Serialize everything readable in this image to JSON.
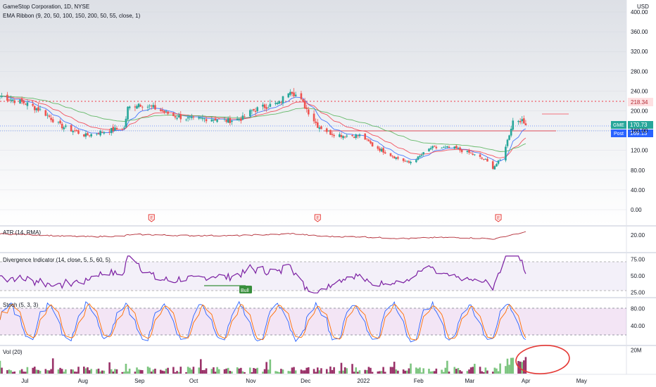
{
  "header": {
    "symbol_line": "GameStop Corporation, 1D, NYSE",
    "indicator_line": "EMA Ribbon (9, 20, 50, 100, 150, 200, 50, 55, close, 1)",
    "currency": "USD"
  },
  "panes": {
    "atr_label": "ATR (14, RMA)",
    "div_label": "Divergence Indicator (14, close, 5, 5, 60, 5)",
    "stoch_label": "Stoch (5, 3, 3)",
    "vol_label": "Vol (20)",
    "bull_label": "Bull",
    "earnings_label": "E"
  },
  "price_tags": {
    "resistance": "218.34",
    "last_symbol": "GME",
    "last_value": "170.73",
    "post_label": "Post",
    "post_value": "169.13"
  },
  "axes": {
    "price_ticks": [
      "400.00",
      "360.00",
      "320.00",
      "280.00",
      "240.00",
      "200.00",
      "160.00",
      "120.00",
      "80.00",
      "40.00",
      "0.00"
    ],
    "atr_ticks": [
      "20.00"
    ],
    "div_ticks": [
      "75.00",
      "50.00",
      "25.00"
    ],
    "stoch_ticks": [
      "80.00",
      "40.00"
    ],
    "vol_ticks": [
      "20M"
    ],
    "x_labels": [
      "Jul",
      "Aug",
      "Sep",
      "Oct",
      "Nov",
      "Dec",
      "2022",
      "Feb",
      "Mar",
      "Apr",
      "May"
    ]
  },
  "colors": {
    "up": "#26a69a",
    "down": "#ef5350",
    "ema_fast": "#2962ff",
    "ema_mid": "#f23645",
    "ema_slow": "#4caf50",
    "atr": "#b22833",
    "div": "#7b1fa2",
    "stoch_k": "#2962ff",
    "stoch_d": "#ff6d00",
    "vol_up": "#66bb6a",
    "vol_down": "#880e4f",
    "annotation": "#e53935"
  },
  "chart_data": {
    "type": "candlestick",
    "symbol": "GME",
    "x_range": [
      "2021-06-17",
      "2022-05-20"
    ],
    "price_ylim": [
      0,
      410
    ],
    "close_anchors": [
      [
        "2021-06-17",
        230
      ],
      [
        "2021-07-01",
        215
      ],
      [
        "2021-07-10",
        200
      ],
      [
        "2021-07-20",
        170
      ],
      [
        "2021-08-03",
        150
      ],
      [
        "2021-08-15",
        160
      ],
      [
        "2021-08-24",
        165
      ],
      [
        "2021-08-26",
        205
      ],
      [
        "2021-09-01",
        215
      ],
      [
        "2021-09-10",
        205
      ],
      [
        "2021-09-20",
        190
      ],
      [
        "2021-10-01",
        182
      ],
      [
        "2021-10-10",
        185
      ],
      [
        "2021-10-20",
        180
      ],
      [
        "2021-10-28",
        185
      ],
      [
        "2021-11-02",
        200
      ],
      [
        "2021-11-10",
        210
      ],
      [
        "2021-11-17",
        215
      ],
      [
        "2021-11-23",
        245
      ],
      [
        "2021-11-30",
        215
      ],
      [
        "2021-12-08",
        170
      ],
      [
        "2021-12-15",
        155
      ],
      [
        "2021-12-22",
        150
      ],
      [
        "2022-01-01",
        150
      ],
      [
        "2022-01-07",
        130
      ],
      [
        "2022-01-20",
        105
      ],
      [
        "2022-01-27",
        95
      ],
      [
        "2022-02-01",
        105
      ],
      [
        "2022-02-08",
        125
      ],
      [
        "2022-02-20",
        125
      ],
      [
        "2022-03-01",
        115
      ],
      [
        "2022-03-10",
        100
      ],
      [
        "2022-03-14",
        85
      ],
      [
        "2022-03-18",
        100
      ],
      [
        "2022-03-22",
        140
      ],
      [
        "2022-03-25",
        180
      ],
      [
        "2022-03-29",
        182
      ],
      [
        "2022-04-01",
        170.73
      ]
    ],
    "last_close": 170.73,
    "post_market": 169.13,
    "resistance_level": 218.34,
    "ema_ribbon_periods": [
      9,
      20,
      50,
      100,
      150,
      200,
      50,
      55
    ],
    "earnings_dates": [
      "2021-09-08",
      "2021-12-08",
      "2022-03-17"
    ],
    "atr": {
      "last": 24,
      "ylim": [
        0,
        30
      ]
    },
    "divergence": {
      "band": [
        30,
        70
      ],
      "ylim": [
        20,
        82
      ],
      "bull_signal_date": "2021-11-03"
    },
    "stoch": {
      "k": 5,
      "d": 3,
      "smooth": 3,
      "band": [
        20,
        80
      ],
      "ylim": [
        0,
        100
      ]
    },
    "volume": {
      "ma_length": 20,
      "ylim_millions": [
        0,
        22
      ]
    }
  }
}
